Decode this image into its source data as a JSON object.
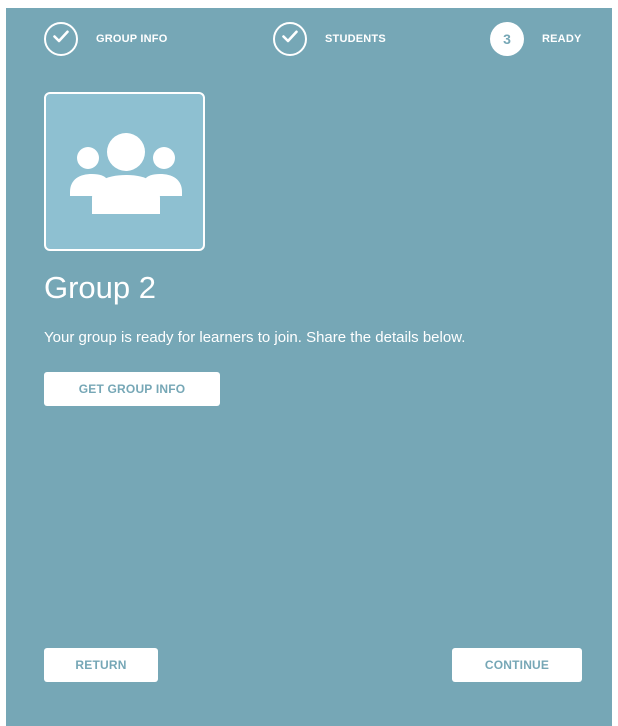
{
  "stepper": {
    "steps": [
      {
        "label": "GROUP INFO",
        "state": "completed",
        "icon": "check-icon"
      },
      {
        "label": "STUDENTS",
        "state": "completed",
        "icon": "check-icon"
      },
      {
        "label": "READY",
        "state": "current",
        "number": "3"
      }
    ]
  },
  "group": {
    "icon": "group-users-icon",
    "title": "Group 2",
    "message": "Your group is ready for learners to join. Share the details below."
  },
  "actions": {
    "get_info_label": "GET GROUP INFO",
    "return_label": "RETURN",
    "continue_label": "CONTINUE"
  },
  "colors": {
    "panel_background": "#76a7b6",
    "icon_box_background": "#8ec0d1",
    "foreground": "#ffffff"
  }
}
